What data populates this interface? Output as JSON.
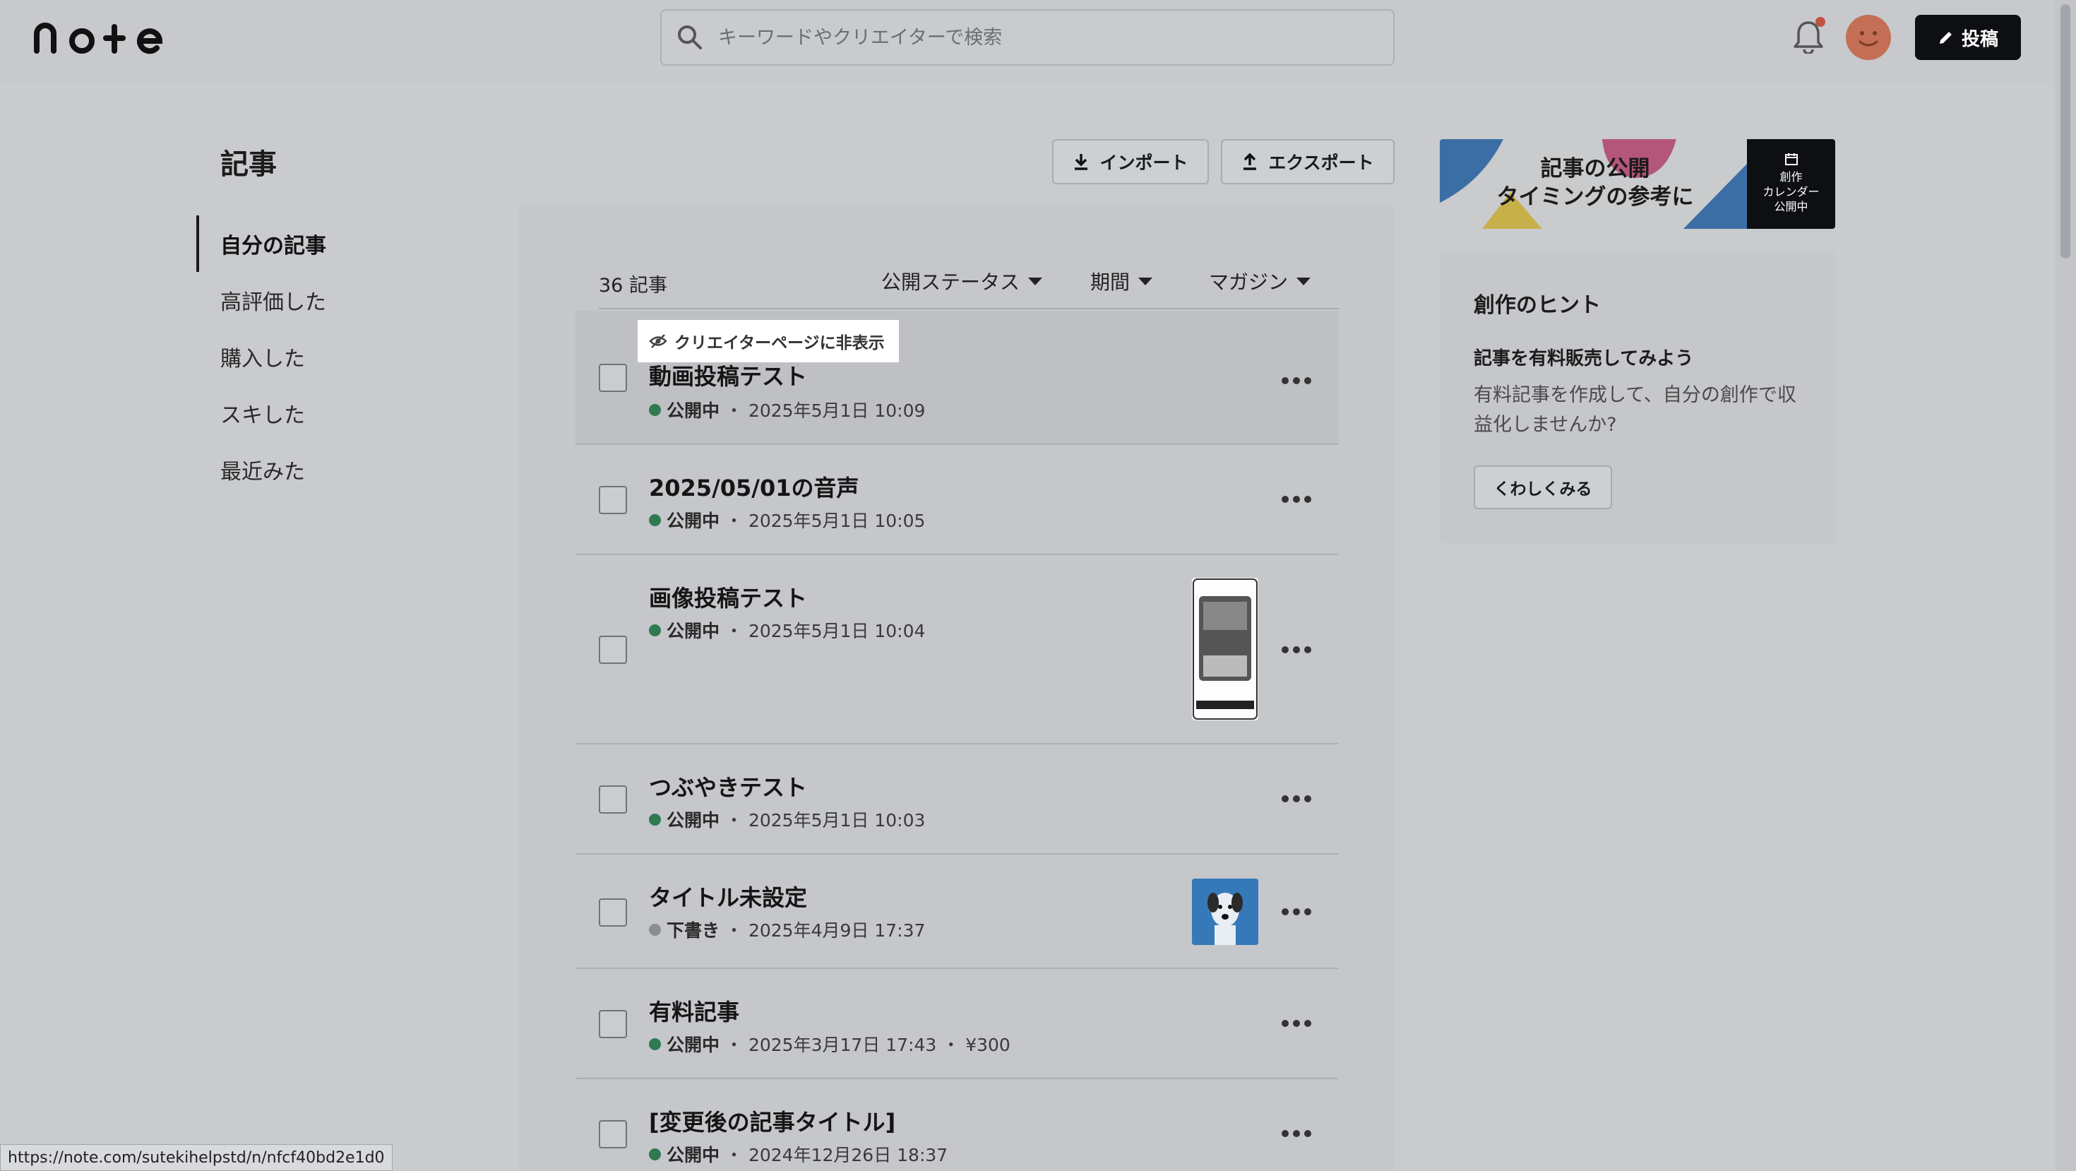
{
  "header": {
    "search_placeholder": "キーワードやクリエイターで検索",
    "post_label": "投稿"
  },
  "page": {
    "title": "記事",
    "import_label": "インポート",
    "export_label": "エクスポート"
  },
  "sidebar": {
    "items": [
      {
        "label": "自分の記事",
        "active": true
      },
      {
        "label": "高評価した"
      },
      {
        "label": "購入した"
      },
      {
        "label": "スキした"
      },
      {
        "label": "最近みた"
      }
    ]
  },
  "list": {
    "count": "36 記事",
    "filters": [
      "公開ステータス",
      "期間",
      "マガジン"
    ],
    "tooltip": "クリエイターページに非表示",
    "articles": [
      {
        "title": "動画投稿テスト",
        "status": "公開中",
        "date": "・ 2025年5月1日 10:09"
      },
      {
        "title": "2025/05/01の音声",
        "status": "公開中",
        "date": "・ 2025年5月1日 10:05"
      },
      {
        "title": "画像投稿テスト",
        "status": "公開中",
        "date": "・ 2025年5月1日 10:04"
      },
      {
        "title": "つぶやきテスト",
        "status": "公開中",
        "date": "・ 2025年5月1日 10:03"
      },
      {
        "title": "タイトル未設定",
        "status": "下書き",
        "date": "・ 2025年4月9日 17:37"
      },
      {
        "title": "有料記事",
        "status": "公開中",
        "date": "・ 2025年3月17日 17:43 ・ ¥300"
      },
      {
        "title": "[変更後の記事タイトル]",
        "status": "公開中",
        "date": "・ 2024年12月26日 18:37"
      }
    ]
  },
  "banner": {
    "line1": "記事の公開",
    "line2": "タイミングの参考に",
    "side_line1": "創作",
    "side_line2": "カレンダー",
    "side_line3": "公開中"
  },
  "hint": {
    "title": "創作のヒント",
    "subtitle": "記事を有料販売してみよう",
    "body": "有料記事を作成して、自分の創作で収益化しませんか?",
    "button": "くわしくみる"
  },
  "status_url": "https://note.com/sutekihelpstd/n/nfcf40bd2e1d0",
  "colors": {
    "published_dot": "#2f7a52",
    "draft_dot": "#8a8c8f",
    "notification": "#c0533d"
  }
}
